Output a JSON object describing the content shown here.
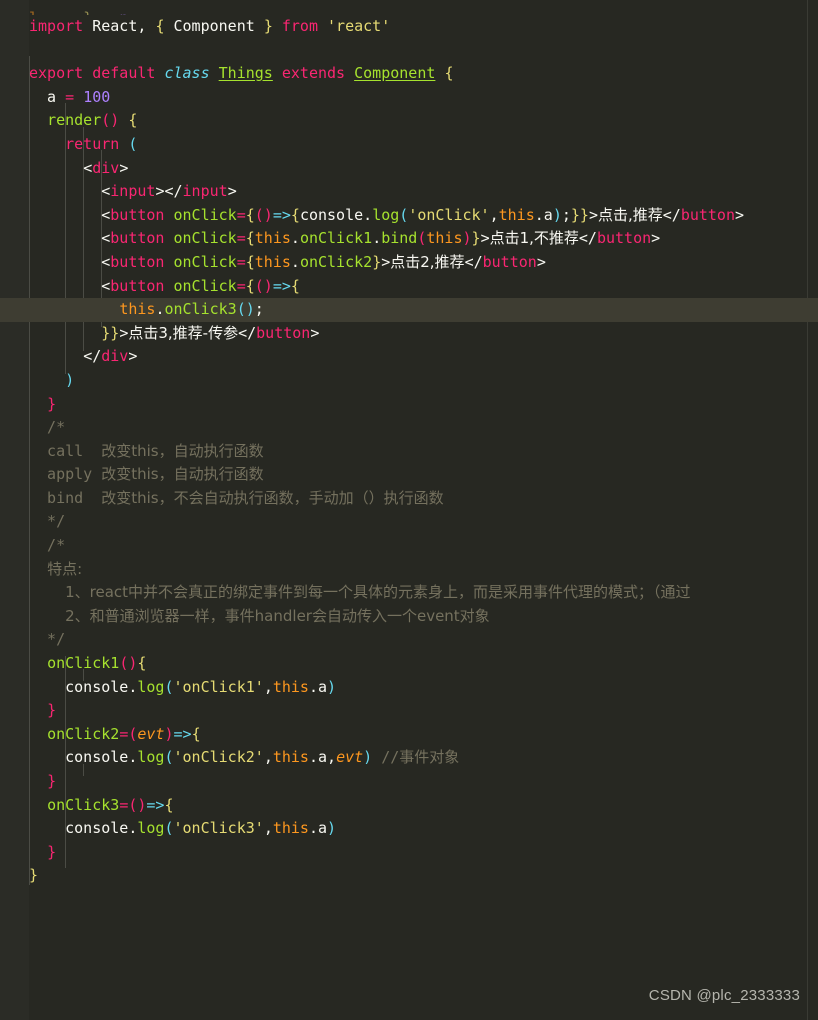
{
  "editor": {
    "theme_name": "monokai",
    "background": "#272822",
    "gutter_background": "#2b2c26",
    "highlight_background": "#3e3d32",
    "foreground": "#f8f8f2",
    "accent_pink": "#f92672",
    "accent_green": "#a6e22e",
    "accent_cyan": "#66d9ef",
    "accent_yellow": "#e6db74",
    "accent_orange": "#fd971f",
    "accent_purple": "#ae81ff",
    "comment_gray": "#75715e"
  },
  "code": {
    "lines": [
      "",
      "import React, { Component } from 'react'",
      "",
      "export default class Things extends Component {",
      "  a = 100",
      "  render() {",
      "    return (",
      "      <div>",
      "        <input></input>",
      "        <button onClick={()=>{console.log('onClick',this.a);}}>点击,推荐</button>",
      "        <button onClick={this.onClick1.bind(this)}>点击1,不推荐</button>",
      "        <button onClick={this.onClick2}>点击2,推荐</button>",
      "        <button onClick={()=>{",
      "          this.onClick3();",
      "        }}>点击3,推荐-传参</button>",
      "      </div>",
      "    )",
      "  }",
      "  /*",
      "  call  改变this，自动执行函数",
      "  apply 改变this，自动执行函数",
      "  bind  改变this，不会自动执行函数，手动加（）执行函数",
      "  */",
      "  /*",
      "  特点:",
      "    1、react中并不会真正的绑定事件到每一个具体的元素身上，而是采用事件代理的模式；（通过",
      "    2、和普通浏览器一样，事件handler会自动传入一个event对象",
      "  */",
      "  onClick1(){",
      "    console.log('onClick1',this.a)",
      "  }",
      "  onClick2=(evt)=>{",
      "    console.log('onClick2',this.a,evt) //事件对象",
      "  }",
      "  onClick3=()=>{",
      "    console.log('onClick3',this.a)",
      "  }",
      "}"
    ],
    "highlighted_line_text": "          this.onClick3();",
    "highlighted_line_number": 14
  },
  "tokens": {
    "import": "import",
    "react_ident": "React",
    "component_ident": "Component",
    "from": "from",
    "react_string": "'react'",
    "export": "export",
    "default": "default",
    "class": "class",
    "things": "Things",
    "extends": "extends",
    "component_class": "Component",
    "a_prop": "a",
    "a_value": "100",
    "render": "render",
    "return": "return",
    "div_tag": "div",
    "input_tag": "input",
    "button_tag": "button",
    "onclick_attr": "onClick",
    "console": "console",
    "log": "log",
    "this": "this",
    "onclick_str": "'onClick'",
    "onclick1_str": "'onClick1'",
    "onclick2_str": "'onClick2'",
    "onclick3_str": "'onClick3'",
    "onclick1": "onClick1",
    "onclick2": "onClick2",
    "onclick3": "onClick3",
    "bind": "bind",
    "evt": "evt",
    "btn_label_0": "点击,推荐",
    "btn_label_1": "点击1,不推荐",
    "btn_label_2": "点击2,推荐",
    "btn_label_3": "点击3,推荐-传参"
  },
  "comments": {
    "call_line": "call  改变this，自动执行函数",
    "apply_line": "apply 改变this，自动执行函数",
    "bind_line": "bind  改变this，不会自动执行函数，手动加（）执行函数",
    "feature_header": "特点:",
    "feature_1": "1、react中并不会真正的绑定事件到每一个具体的元素身上，而是采用事件代理的模式；（通过",
    "feature_2": "2、和普通浏览器一样，事件handler会自动传入一个event对象",
    "event_object": "//事件对象",
    "block_open": "/*",
    "block_close": "*/"
  },
  "watermark": {
    "text": "CSDN @plc_2333333"
  }
}
